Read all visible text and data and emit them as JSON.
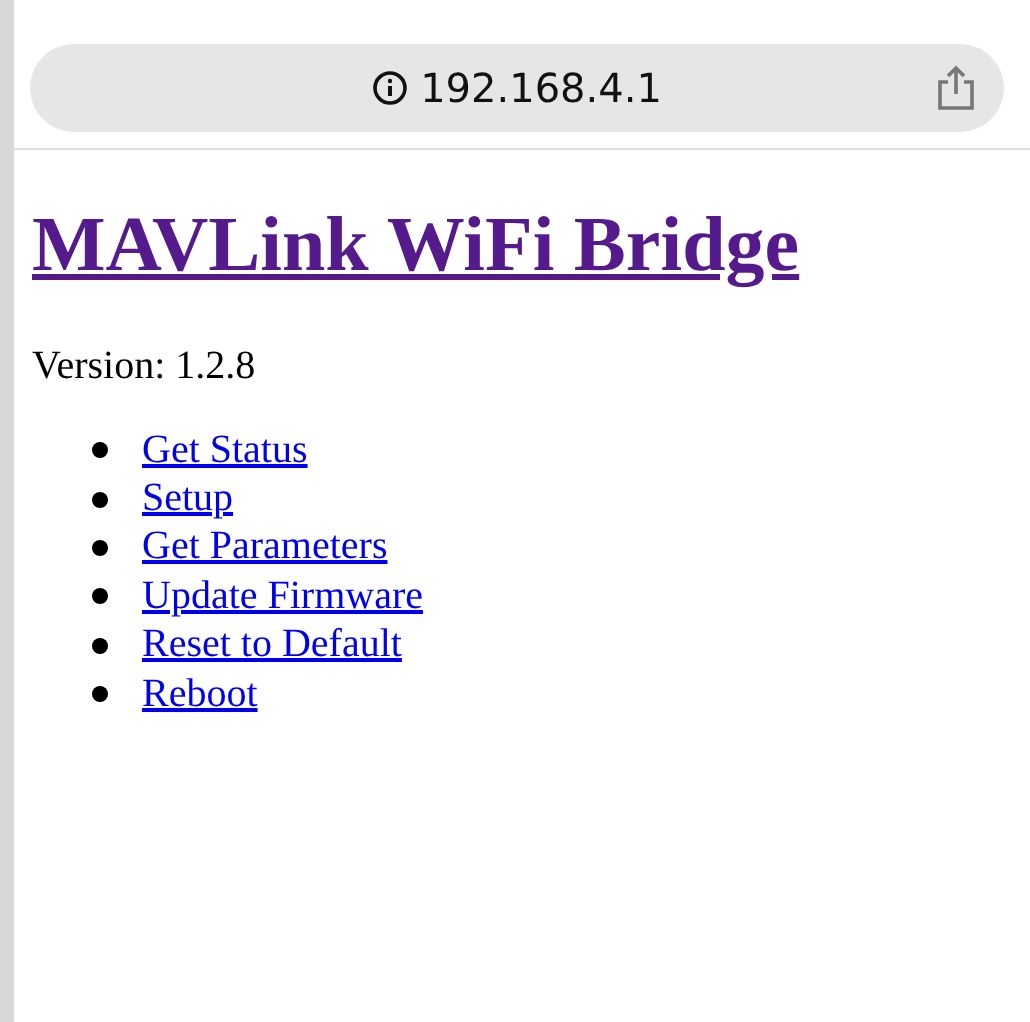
{
  "address_bar": {
    "url": "192.168.4.1"
  },
  "title": "MAVLink WiFi Bridge",
  "version": "Version: 1.2.8",
  "links": [
    {
      "label": "Get Status"
    },
    {
      "label": "Setup"
    },
    {
      "label": "Get Parameters"
    },
    {
      "label": "Update Firmware"
    },
    {
      "label": "Reset to Default"
    },
    {
      "label": "Reboot"
    }
  ]
}
